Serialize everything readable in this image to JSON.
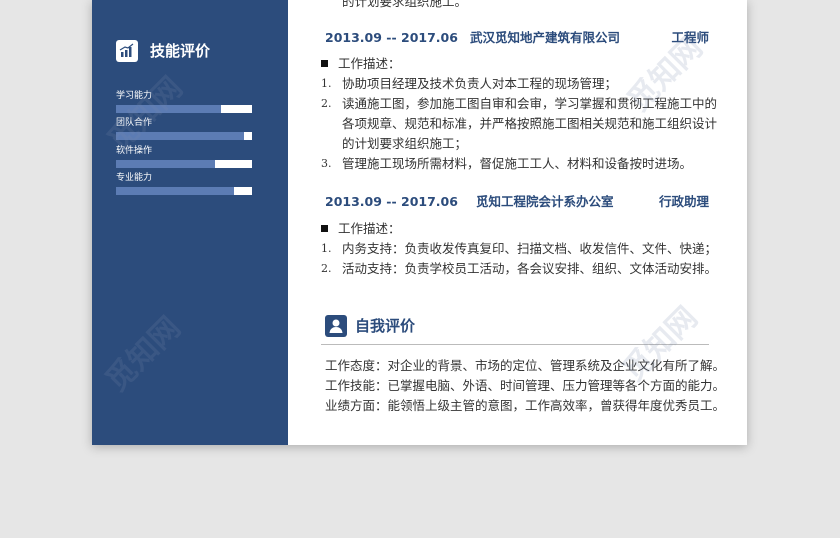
{
  "sidebar": {
    "skills_title": "技能评价",
    "skills": [
      {
        "label": "学习能力",
        "level": 0.77
      },
      {
        "label": "团队合作",
        "level": 0.94
      },
      {
        "label": "软件操作",
        "level": 0.73
      },
      {
        "label": "专业能力",
        "level": 0.87
      }
    ]
  },
  "cut_top_text": "的计划要求组织施工。",
  "jobs": [
    {
      "date": "2013.09 -- 2017.06",
      "company": "武汉觅知地产建筑有限公司",
      "role": "工程师",
      "desc_label": "工作描述：",
      "items": [
        {
          "num": "1.",
          "text": "协助项目经理及技术负责人对本工程的现场管理；"
        },
        {
          "num": "2.",
          "text": "读通施工图，参加施工图自审和会审，学习掌握和贯彻工程施工中的各项规章、规范和标准，并严格按照施工图相关规范和施工组织设计的计划要求组织施工；"
        },
        {
          "num": "3.",
          "text": "管理施工现场所需材料，督促施工工人、材料和设备按时进场。"
        }
      ]
    },
    {
      "date": "2013.09 -- 2017.06",
      "company": "觅知工程院会计系办公室",
      "role": "行政助理",
      "desc_label": "工作描述：",
      "items": [
        {
          "num": "1.",
          "text": "内务支持：负责收发传真复印、扫描文档、收发信件、文件、快递；"
        },
        {
          "num": "2.",
          "text": "活动支持：负责学校员工活动，各会议安排、组织、文体活动安排。"
        }
      ]
    }
  ],
  "self_eval": {
    "title": "自我评价",
    "lines": [
      "工作态度：对企业的背景、市场的定位、管理系统及企业文化有所了解。",
      "工作技能：已掌握电脑、外语、时间管理、压力管理等各个方面的能力。",
      "业绩方面：能领悟上级主管的意图，工作高效率，曾获得年度优秀员工。"
    ]
  },
  "watermark": "觅知网",
  "colors": {
    "primary": "#2c4c7c",
    "bar_fill": "#5c7cb4"
  }
}
